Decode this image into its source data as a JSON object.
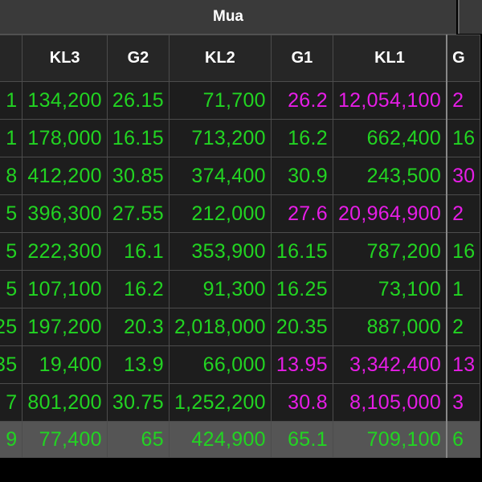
{
  "header": {
    "group_label": "Mua"
  },
  "columns": {
    "kl3": "KL3",
    "g2": "G2",
    "kl2": "KL2",
    "g1": "G1",
    "kl1": "KL1",
    "next": "G"
  },
  "colors": {
    "up": "#22d422",
    "ceiling": "#e61de6",
    "text": "#ffffff"
  },
  "rows": [
    {
      "prev": "1",
      "kl3": "134,200",
      "g2": "26.15",
      "kl2": "71,700",
      "g1": "26.2",
      "kl1": "12,054,100",
      "next": "2",
      "g1_color": "ceiling",
      "next_color": "ceiling"
    },
    {
      "prev": "1",
      "kl3": "178,000",
      "g2": "16.15",
      "kl2": "713,200",
      "g1": "16.2",
      "kl1": "662,400",
      "next": "16",
      "g1_color": "up",
      "next_color": "up"
    },
    {
      "prev": "8",
      "kl3": "412,200",
      "g2": "30.85",
      "kl2": "374,400",
      "g1": "30.9",
      "kl1": "243,500",
      "next": "30",
      "g1_color": "up",
      "next_color": "ceiling"
    },
    {
      "prev": "5",
      "kl3": "396,300",
      "g2": "27.55",
      "kl2": "212,000",
      "g1": "27.6",
      "kl1": "20,964,900",
      "next": "2",
      "g1_color": "ceiling",
      "next_color": "ceiling"
    },
    {
      "prev": "5",
      "kl3": "222,300",
      "g2": "16.1",
      "kl2": "353,900",
      "g1": "16.15",
      "kl1": "787,200",
      "next": "16",
      "g1_color": "up",
      "next_color": "up"
    },
    {
      "prev": "5",
      "kl3": "107,100",
      "g2": "16.2",
      "kl2": "91,300",
      "g1": "16.25",
      "kl1": "73,100",
      "next": "1",
      "g1_color": "up",
      "next_color": "up"
    },
    {
      "prev": "25",
      "kl3": "197,200",
      "g2": "20.3",
      "kl2": "2,018,000",
      "g1": "20.35",
      "kl1": "887,000",
      "next": "2",
      "g1_color": "up",
      "next_color": "up"
    },
    {
      "prev": "35",
      "kl3": "19,400",
      "g2": "13.9",
      "kl2": "66,000",
      "g1": "13.95",
      "kl1": "3,342,400",
      "next": "13",
      "g1_color": "ceiling",
      "next_color": "ceiling"
    },
    {
      "prev": "7",
      "kl3": "801,200",
      "g2": "30.75",
      "kl2": "1,252,200",
      "g1": "30.8",
      "kl1": "8,105,000",
      "next": "3",
      "g1_color": "ceiling",
      "next_color": "ceiling"
    },
    {
      "prev": "9",
      "kl3": "77,400",
      "g2": "65",
      "kl2": "424,900",
      "g1": "65.1",
      "kl1": "709,100",
      "next": "6",
      "g1_color": "up",
      "next_color": "up"
    }
  ]
}
